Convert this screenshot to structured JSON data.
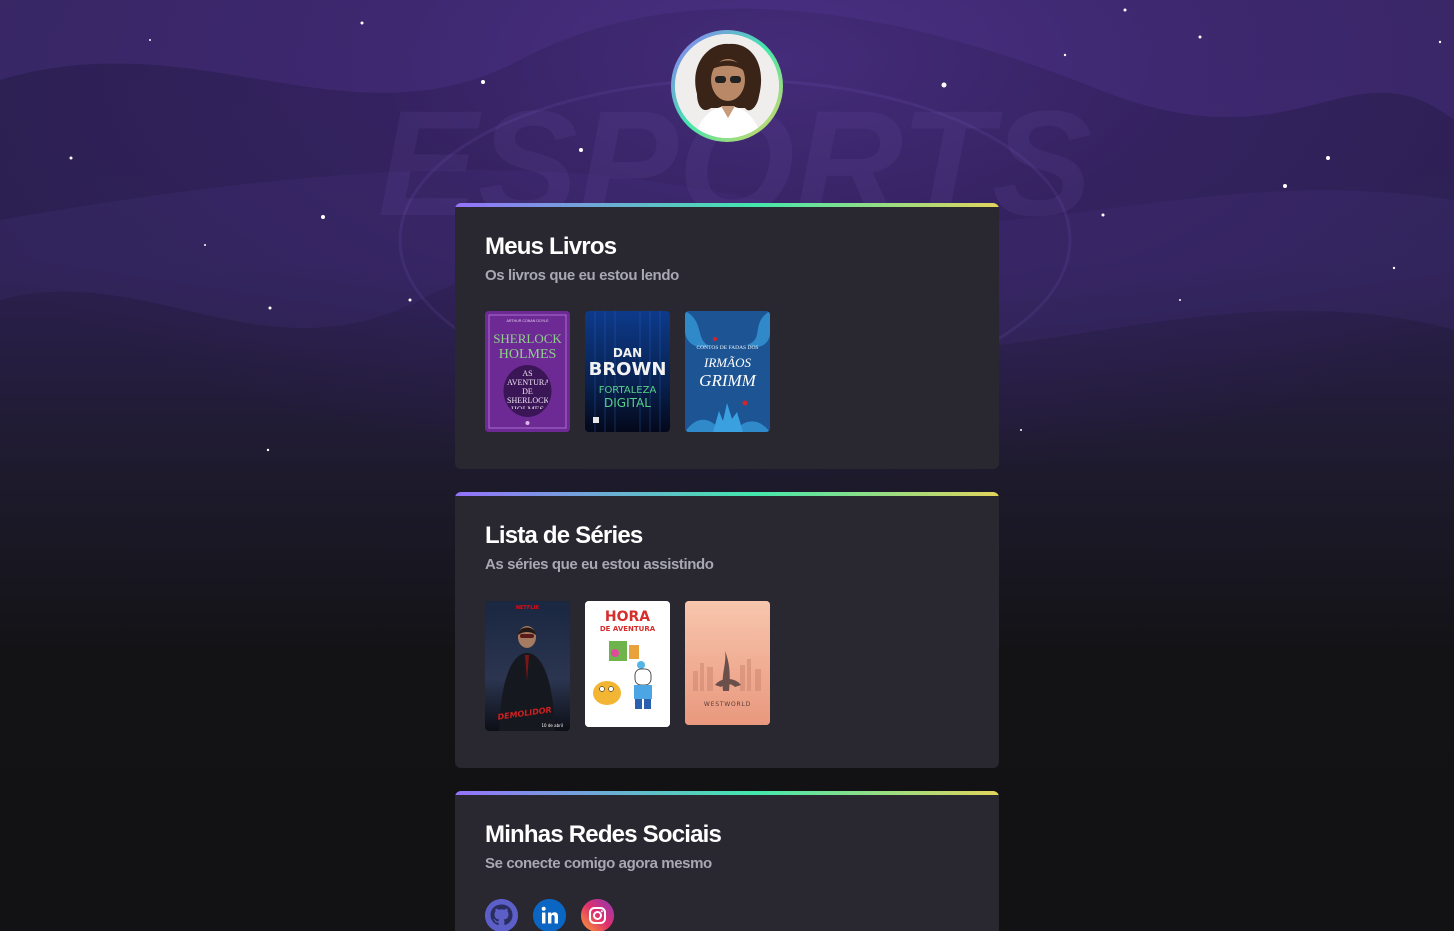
{
  "profile": {
    "avatar_alt": "Foto de perfil"
  },
  "books": {
    "title": "Meus Livros",
    "subtitle": "Os livros que eu estou lendo",
    "items": [
      {
        "l1": "ARTHUR CONAN DOYLE",
        "l2": "SHERLOCK",
        "l3": "HOLMES",
        "l4": "AS AVENTURAS DE SHERLOCK HOLMES"
      },
      {
        "l1": "DAN",
        "l2": "BROWN",
        "l3": "FORTALEZA",
        "l4": "DIGITAL"
      },
      {
        "l1": "CONTOS DE FADAS DOS",
        "l2": "IRMÃOS",
        "l3": "GRIMM",
        "l4": ""
      }
    ]
  },
  "series": {
    "title": "Lista de Séries",
    "subtitle": "As séries que eu estou assistindo",
    "items": [
      {
        "l1": "NETFLIX",
        "l2": "DEMOLIDOR",
        "l3": "10 de abril"
      },
      {
        "l1": "HORA",
        "l2": "DE AVENTURA",
        "l3": ""
      },
      {
        "l1": "WESTWORLD",
        "l2": "",
        "l3": ""
      }
    ]
  },
  "social": {
    "title": "Minhas Redes Sociais",
    "subtitle": "Se conecte comigo agora mesmo",
    "items": [
      {
        "icon": "github-icon",
        "color": "#5b5fc7"
      },
      {
        "icon": "linkedin-icon",
        "color": "#0a66c2"
      },
      {
        "icon": "instagram-icon",
        "color": "#e1306c"
      }
    ]
  },
  "background": {
    "watermark": "ESPORTS"
  },
  "colors": {
    "gradient": [
      "#9572fc",
      "#43e7ad",
      "#e2d45c"
    ],
    "card": "#29272f",
    "muted": "#a8a8b3"
  }
}
